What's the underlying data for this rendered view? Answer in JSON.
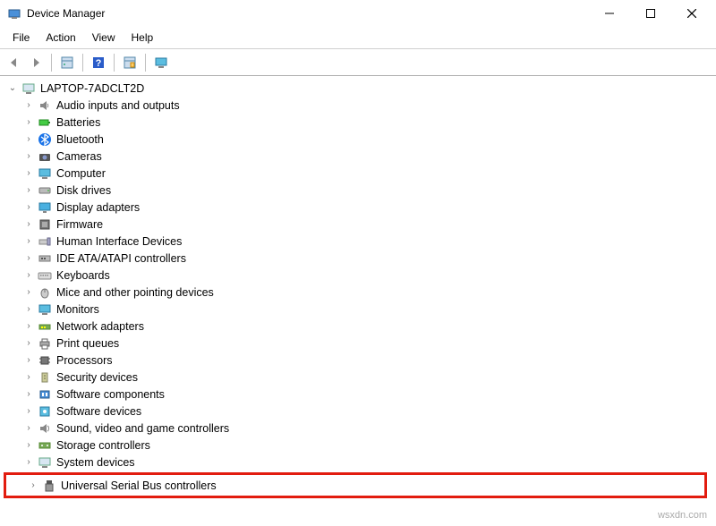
{
  "window": {
    "title": "Device Manager"
  },
  "menu": {
    "file": "File",
    "action": "Action",
    "view": "View",
    "help": "Help"
  },
  "tree": {
    "root": "LAPTOP-7ADCLT2D",
    "nodes": [
      "Audio inputs and outputs",
      "Batteries",
      "Bluetooth",
      "Cameras",
      "Computer",
      "Disk drives",
      "Display adapters",
      "Firmware",
      "Human Interface Devices",
      "IDE ATA/ATAPI controllers",
      "Keyboards",
      "Mice and other pointing devices",
      "Monitors",
      "Network adapters",
      "Print queues",
      "Processors",
      "Security devices",
      "Software components",
      "Software devices",
      "Sound, video and game controllers",
      "Storage controllers",
      "System devices",
      "Universal Serial Bus controllers"
    ]
  },
  "watermark": "wsxdn.com"
}
